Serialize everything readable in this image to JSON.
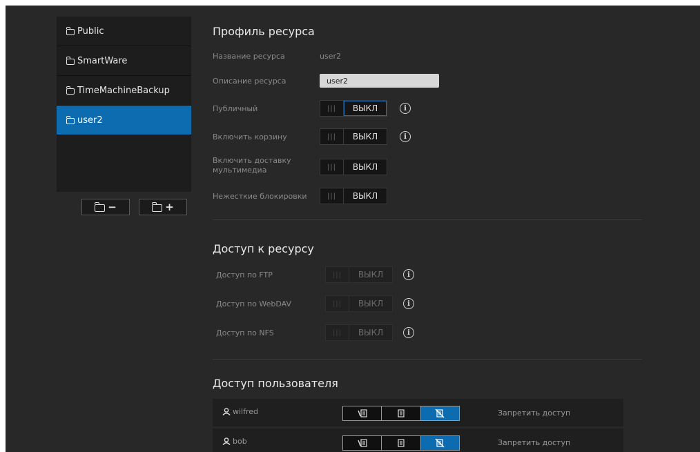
{
  "sidebar": {
    "shares": [
      {
        "label": "Public"
      },
      {
        "label": "SmartWare"
      },
      {
        "label": "TimeMachineBackup"
      },
      {
        "label": "user2",
        "active": true
      }
    ],
    "remove_button": {
      "label": "−",
      "icon": "folder-minus-icon"
    },
    "add_button": {
      "label": "+",
      "icon": "folder-plus-icon"
    }
  },
  "profile": {
    "title": "Профиль ресурса",
    "name_label": "Название ресурса",
    "name_value": "user2",
    "description_label": "Описание ресурса",
    "description_value": "user2",
    "public_label": "Публичный",
    "recycle_label": "Включить корзину",
    "media_label": "Включить доставку мультимедиа",
    "oplocks_label": "Нежесткие блокировки"
  },
  "toggle": {
    "grip": "|||",
    "off": "ВЫКЛ"
  },
  "access": {
    "title": "Доступ к ресурсу",
    "ftp_label": "Доступ по FTP",
    "webdav_label": "Доступ по WebDAV",
    "nfs_label": "Доступ по NFS"
  },
  "users": {
    "title": "Доступ пользователя",
    "rows": [
      {
        "name": "wilfred",
        "action": "Запретить доступ",
        "selected_permission": "no-access"
      },
      {
        "name": "bob",
        "action": "Запретить доступ",
        "selected_permission": "no-access"
      }
    ]
  },
  "colors": {
    "accent": "#0d6bb0",
    "background": "#282828",
    "panel": "#1d1d1d"
  }
}
